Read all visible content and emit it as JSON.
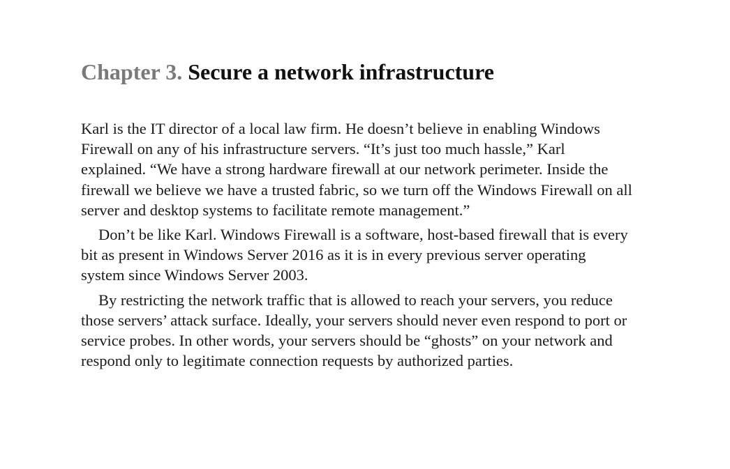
{
  "chapter": {
    "label": "Chapter 3.",
    "title": "Secure a network infrastructure"
  },
  "paragraphs": [
    "Karl is the IT director of a local law firm. He doesn’t believe in enabling Windows Firewall on any of his infrastructure servers. “It’s just too much hassle,” Karl explained. “We have a strong hardware firewall at our network perimeter. Inside the firewall we believe we have a trusted fabric, so we turn off the Windows Firewall on all server and desktop systems to facilitate remote management.”",
    "Don’t be like Karl. Windows Firewall is a software, host-based firewall that is every bit as present in Windows Server 2016 as it is in every previous server operating system since Windows Server 2003.",
    "By restricting the network traffic that is allowed to reach your servers, you reduce those servers’ attack surface. Ideally, your servers should never even respond to port or service probes. In other words, your servers should be “ghosts” on your network and respond only to legitimate connection requests by authorized parties."
  ]
}
